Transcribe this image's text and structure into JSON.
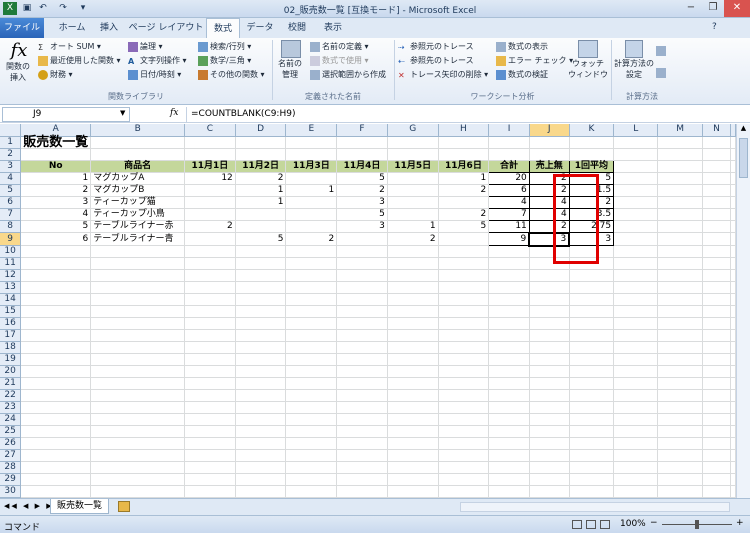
{
  "window": {
    "title": "02_販売数一覧 [互換モード] - Microsoft Excel"
  },
  "tabs": {
    "file": "ファイル",
    "items": [
      "ホーム",
      "挿入",
      "ページ レイアウト",
      "数式",
      "データ",
      "校閲",
      "表示"
    ]
  },
  "ribbon": {
    "insert_func": "関数の挿入",
    "autosum": "オート SUM",
    "recent": "最近使用した関数",
    "finance": "財務",
    "logical": "論理",
    "text": "文字列操作",
    "datetime": "日付/時刻",
    "lookup": "検索/行列",
    "math": "数学/三角",
    "more": "その他の関数",
    "group_lib": "関数ライブラリ",
    "name_mgr": "名前の管理",
    "define_name": "名前の定義",
    "use_in_formula": "数式で使用",
    "create_sel": "選択範囲から作成",
    "group_names": "定義された名前",
    "trace_prec": "参照元のトレース",
    "trace_dep": "参照先のトレース",
    "remove_arrows": "トレース矢印の削除",
    "show_formulas": "数式の表示",
    "error_check": "エラー チェック",
    "evaluate": "数式の検証",
    "watch": "ウォッチ ウィンドウ",
    "group_audit": "ワークシート分析",
    "calc_opts": "計算方法の設定",
    "group_calc": "計算方法"
  },
  "formula_bar": {
    "name_box": "J9",
    "fx": "fx",
    "formula": "=COUNTBLANK(C9:H9)"
  },
  "columns": [
    "A",
    "B",
    "C",
    "D",
    "E",
    "F",
    "G",
    "H",
    "I",
    "J",
    "K",
    "L",
    "M",
    "N"
  ],
  "sheet": {
    "title": "販売数一覧",
    "headers": [
      "No",
      "商品名",
      "11月1日",
      "11月2日",
      "11月3日",
      "11月4日",
      "11月5日",
      "11月6日",
      "合計",
      "売上無",
      "1回平均"
    ],
    "rows": [
      [
        "1",
        "マグカップA",
        "12",
        "2",
        "",
        "5",
        "",
        "1",
        "20",
        "2",
        "5"
      ],
      [
        "2",
        "マグカップB",
        "",
        "1",
        "1",
        "2",
        "",
        "2",
        "6",
        "2",
        "1.5"
      ],
      [
        "3",
        "ティーカップ猫",
        "",
        "1",
        "",
        "3",
        "",
        "",
        "4",
        "4",
        "2"
      ],
      [
        "4",
        "ティーカップ小鳥",
        "",
        "",
        "",
        "5",
        "",
        "2",
        "7",
        "4",
        "3.5"
      ],
      [
        "5",
        "テーブルライナー赤",
        "2",
        "",
        "",
        "3",
        "1",
        "5",
        "11",
        "2",
        "2.75"
      ],
      [
        "6",
        "テーブルライナー青",
        "",
        "5",
        "2",
        "",
        "2",
        "",
        "9",
        "3",
        "3"
      ]
    ]
  },
  "sheet_tab": "販売数一覧",
  "status": {
    "mode": "コマンド",
    "zoom": "100%"
  }
}
